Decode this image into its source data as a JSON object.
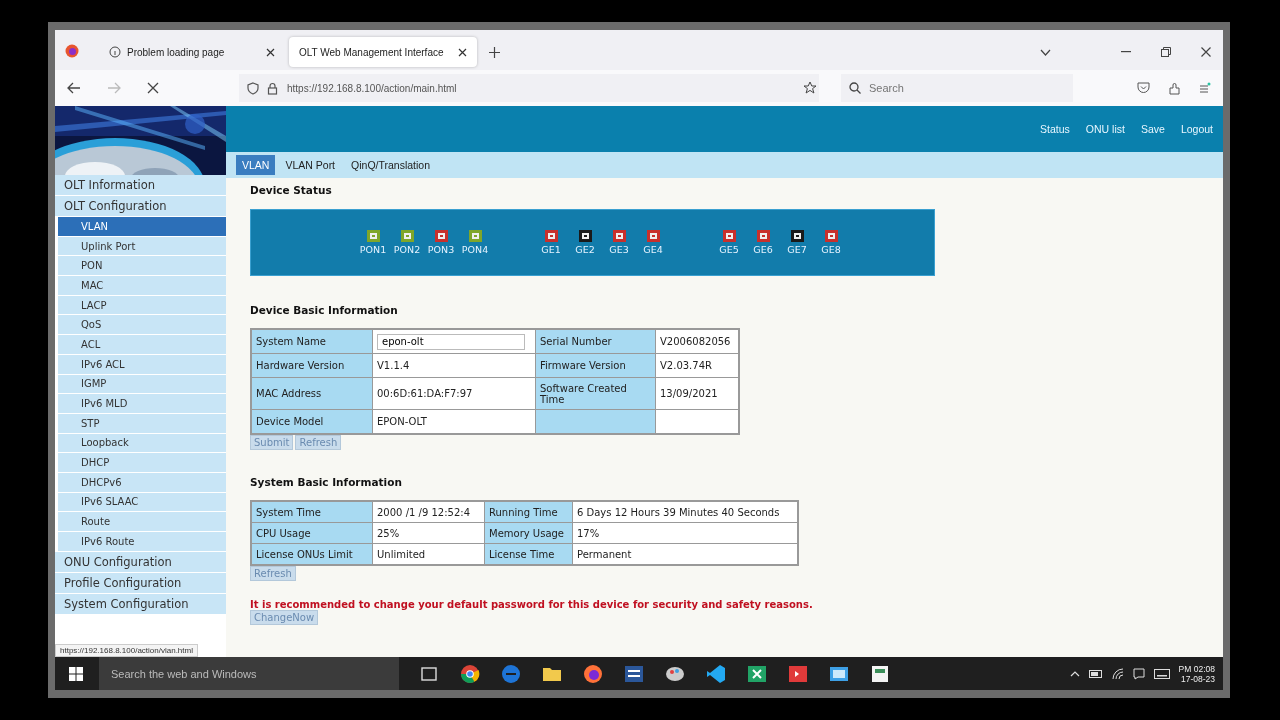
{
  "browser": {
    "tabs": [
      {
        "title": "Problem loading page",
        "selected": false
      },
      {
        "title": "OLT Web Management Interface",
        "selected": true
      }
    ],
    "url": "https://192.168.8.100/action/main.html",
    "search": {
      "placeholder": "Search"
    }
  },
  "header": {
    "links": [
      "Status",
      "ONU list",
      "Save",
      "Logout"
    ]
  },
  "subtabs": [
    {
      "label": "VLAN",
      "selected": true
    },
    {
      "label": "VLAN Port",
      "selected": false
    },
    {
      "label": "QinQ/Translation",
      "selected": false
    }
  ],
  "sidebar": [
    {
      "label": "OLT Information"
    },
    {
      "label": "OLT Configuration",
      "children": [
        {
          "label": "VLAN",
          "selected": true
        },
        {
          "label": "Uplink Port",
          "selected": false
        },
        {
          "label": "PON",
          "selected": false
        },
        {
          "label": "MAC",
          "selected": false
        },
        {
          "label": "LACP",
          "selected": false
        },
        {
          "label": "QoS",
          "selected": false
        },
        {
          "label": "ACL",
          "selected": false
        },
        {
          "label": "IPv6 ACL",
          "selected": false
        },
        {
          "label": "IGMP",
          "selected": false
        },
        {
          "label": "IPv6 MLD",
          "selected": false
        },
        {
          "label": "STP",
          "selected": false
        },
        {
          "label": "Loopback",
          "selected": false
        },
        {
          "label": "DHCP",
          "selected": false
        },
        {
          "label": "DHCPv6",
          "selected": false
        },
        {
          "label": "IPv6 SLAAC",
          "selected": false
        },
        {
          "label": "Route",
          "selected": false
        },
        {
          "label": "IPv6 Route",
          "selected": false
        }
      ]
    },
    {
      "label": "ONU Configuration"
    },
    {
      "label": "Profile Configuration"
    },
    {
      "label": "System Configuration"
    }
  ],
  "device_status": {
    "title": "Device Status",
    "groups": [
      [
        {
          "label": "PON1",
          "color": "#7fa62a"
        },
        {
          "label": "PON2",
          "color": "#7fa62a"
        },
        {
          "label": "PON3",
          "color": "#c8302c"
        },
        {
          "label": "PON4",
          "color": "#7fa62a"
        }
      ],
      [
        {
          "label": "GE1",
          "color": "#c8302c"
        },
        {
          "label": "GE2",
          "color": "#1a1a1a"
        },
        {
          "label": "GE3",
          "color": "#c8302c"
        },
        {
          "label": "GE4",
          "color": "#c8302c"
        }
      ],
      [
        {
          "label": "GE5",
          "color": "#c8302c"
        },
        {
          "label": "GE6",
          "color": "#c8302c"
        },
        {
          "label": "GE7",
          "color": "#1a1a1a"
        },
        {
          "label": "GE8",
          "color": "#c8302c"
        }
      ]
    ]
  },
  "device_info": {
    "title": "Device Basic Information",
    "rows": [
      {
        "cells": [
          {
            "kind": "label",
            "text": "System Name"
          },
          {
            "kind": "input",
            "text": "epon-olt"
          },
          {
            "kind": "label",
            "text": "Serial Number"
          },
          {
            "kind": "value",
            "text": "V2006082056"
          }
        ]
      },
      {
        "cells": [
          {
            "kind": "label",
            "text": "Hardware Version"
          },
          {
            "kind": "value",
            "text": "V1.1.4"
          },
          {
            "kind": "label",
            "text": "Firmware Version"
          },
          {
            "kind": "value",
            "text": "V2.03.74R"
          }
        ]
      },
      {
        "cells": [
          {
            "kind": "label",
            "text": "MAC Address"
          },
          {
            "kind": "value",
            "text": "00:6D:61:DA:F7:97"
          },
          {
            "kind": "label",
            "text": "Software Created Time"
          },
          {
            "kind": "value",
            "text": "13/09/2021"
          }
        ]
      },
      {
        "cells": [
          {
            "kind": "label",
            "text": "Device Model"
          },
          {
            "kind": "value",
            "text": "EPON-OLT"
          },
          {
            "kind": "label"
          },
          {
            "kind": "value"
          }
        ]
      }
    ],
    "buttons": [
      "Submit",
      "Refresh"
    ]
  },
  "system_info": {
    "title": "System Basic Information",
    "rows": [
      {
        "cells": [
          {
            "kind": "label",
            "text": "System Time"
          },
          {
            "kind": "value",
            "text": "2000 /1 /9 12:52:4"
          },
          {
            "kind": "label",
            "text": "Running Time"
          },
          {
            "kind": "value",
            "text": "6 Days 12 Hours 39 Minutes 40 Seconds"
          }
        ]
      },
      {
        "cells": [
          {
            "kind": "label",
            "text": "CPU Usage"
          },
          {
            "kind": "value",
            "text": "25%"
          },
          {
            "kind": "label",
            "text": "Memory Usage"
          },
          {
            "kind": "value",
            "text": "17%"
          }
        ]
      },
      {
        "cells": [
          {
            "kind": "label",
            "text": "License ONUs Limit"
          },
          {
            "kind": "value",
            "text": "Unlimited"
          },
          {
            "kind": "label",
            "text": "License Time"
          },
          {
            "kind": "value",
            "text": "Permanent"
          }
        ]
      }
    ],
    "buttons": [
      "Refresh"
    ]
  },
  "warning": {
    "text": "It is recommended to change your default password for this device for security and safety reasons.",
    "button": "ChangeNow"
  },
  "status_link": "https://192.168.8.100/action/vlan.html",
  "taskbar": {
    "search": {
      "placeholder": "Search the web and Windows"
    },
    "time": "PM 02:08",
    "date": "17-08-23"
  }
}
